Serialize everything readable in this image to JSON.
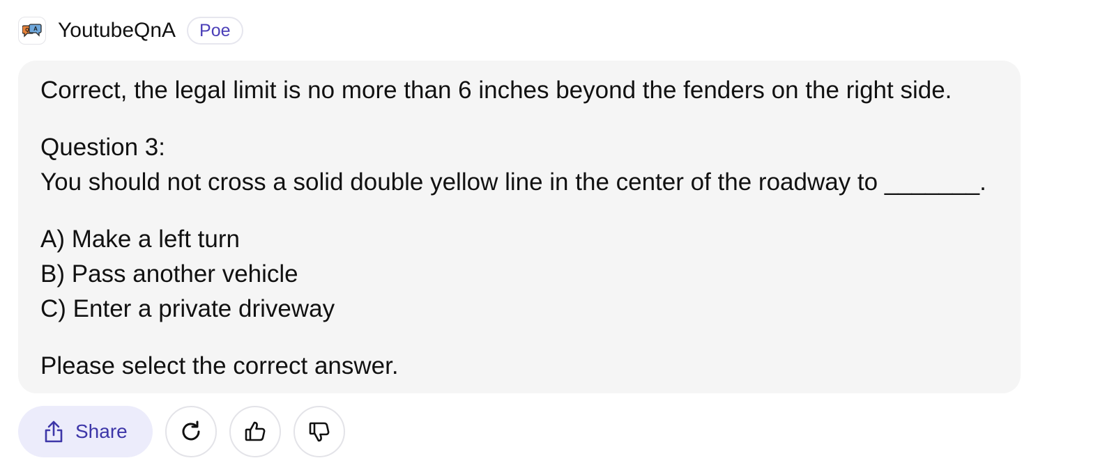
{
  "header": {
    "bot_name": "YoutubeQnA",
    "badge": "Poe",
    "avatar_icon": "chat-bubbles-icon"
  },
  "message": {
    "line1": "Correct, the legal limit is no more than 6 inches beyond the fenders on the right side.",
    "question_heading": "Question 3:",
    "question_text": "You should not cross a solid double yellow line in the center of the roadway to _______.",
    "option_a": "A) Make a left turn",
    "option_b": "B) Pass another vehicle",
    "option_c": "C) Enter a private driveway",
    "prompt": "Please select the correct answer."
  },
  "actions": {
    "share_label": "Share",
    "share_icon": "share-icon",
    "retry_icon": "retry-icon",
    "like_icon": "thumbs-up-icon",
    "dislike_icon": "thumbs-down-icon"
  },
  "colors": {
    "accent": "#3d36a8",
    "share_bg": "#ececfb",
    "bubble_bg": "#f5f5f5"
  }
}
